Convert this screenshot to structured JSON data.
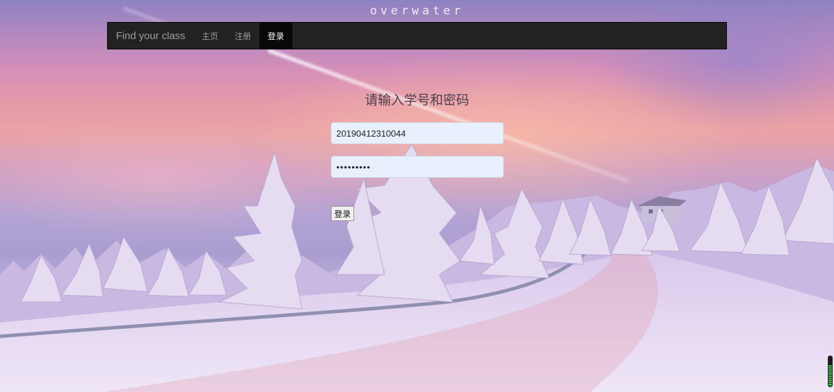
{
  "brand": "overwater",
  "navbar": {
    "brand": "Find your class",
    "links": [
      "主页",
      "注册",
      "登录"
    ],
    "active_index": 2
  },
  "form": {
    "title": "请输入学号和密码",
    "username_value": "20190412310044",
    "password_mask": "•••••••••",
    "submit_label": "登录"
  },
  "scroll_indicator": {
    "level": 0.7,
    "color": "#3fc94f"
  }
}
